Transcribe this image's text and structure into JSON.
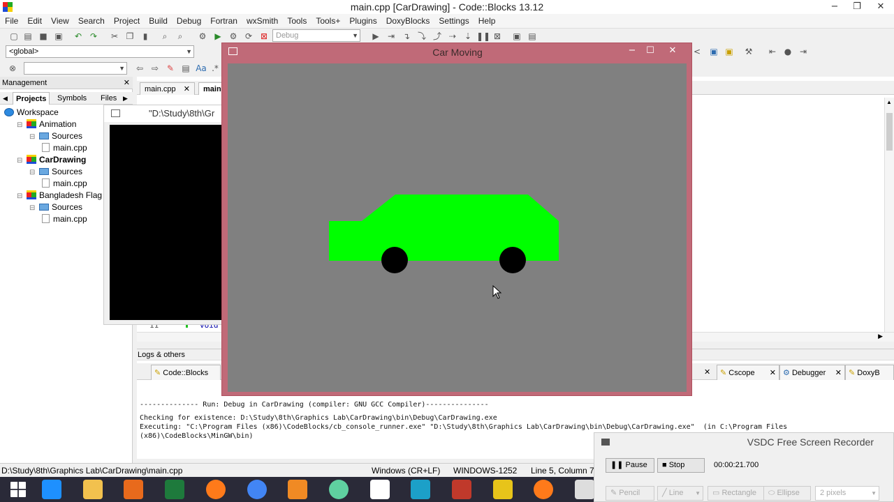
{
  "window": {
    "title": "main.cpp [CarDrawing] - Code::Blocks 13.12",
    "minimize": "−",
    "restore": "❐",
    "close": "✕"
  },
  "menu": [
    "File",
    "Edit",
    "View",
    "Search",
    "Project",
    "Build",
    "Debug",
    "Fortran",
    "wxSmith",
    "Tools",
    "Tools+",
    "Plugins",
    "DoxyBlocks",
    "Settings",
    "Help"
  ],
  "toolbar": {
    "build_target": "Debug",
    "scope": "<global>",
    "search_value": ""
  },
  "management": {
    "title": "Management",
    "close": "✕",
    "tabs": [
      "Projects",
      "Symbols",
      "Files"
    ],
    "tree": [
      {
        "label": "Workspace",
        "level": 0,
        "kind": "workspace"
      },
      {
        "label": "Animation",
        "level": 1,
        "kind": "project"
      },
      {
        "label": "Sources",
        "level": 2,
        "kind": "folder"
      },
      {
        "label": "main.cpp",
        "level": 3,
        "kind": "file"
      },
      {
        "label": "CarDrawing",
        "level": 1,
        "kind": "project",
        "active": true
      },
      {
        "label": "Sources",
        "level": 2,
        "kind": "folder"
      },
      {
        "label": "main.cpp",
        "level": 3,
        "kind": "file"
      },
      {
        "label": "Bangladesh Flag",
        "level": 1,
        "kind": "project"
      },
      {
        "label": "Sources",
        "level": 2,
        "kind": "folder"
      },
      {
        "label": "main.cpp",
        "level": 3,
        "kind": "file"
      }
    ]
  },
  "editor": {
    "tabs": [
      "main.cpp",
      "main"
    ],
    "visible_line_number": "11",
    "visible_line_text": "void"
  },
  "console_window": {
    "title": "\"D:\\Study\\8th\\Gr"
  },
  "car_window": {
    "title": "Car Moving",
    "minimize": "−",
    "maximize": "☐",
    "close": "✕",
    "canvas_bg": "#808080",
    "car_color": "#00ff00",
    "wheel_color": "#000000"
  },
  "logs": {
    "title": "Logs & others",
    "tabs_left": [
      "Code::Blocks"
    ],
    "tabs_right": [
      "Cscope",
      "Debugger",
      "DoxyB"
    ],
    "lines": [
      "-------------- Run: Debug in CarDrawing (compiler: GNU GCC Compiler)---------------",
      "Checking for existence: D:\\Study\\8th\\Graphics Lab\\CarDrawing\\bin\\Debug\\CarDrawing.exe",
      "Executing: \"C:\\Program Files (x86)\\CodeBlocks/cb_console_runner.exe\" \"D:\\Study\\8th\\Graphics Lab\\CarDrawing\\bin\\Debug\\CarDrawing.exe\"  (in C:\\Program Files",
      "(x86)\\CodeBlocks\\MinGW\\bin)"
    ]
  },
  "status": {
    "path": "D:\\Study\\8th\\Graphics Lab\\CarDrawing\\main.cpp",
    "eol": "Windows (CR+LF)",
    "encoding": "WINDOWS-1252",
    "position": "Line 5, Column 7"
  },
  "recorder": {
    "title": "VSDC Free Screen Recorder",
    "pause": "Pause",
    "stop": "Stop",
    "time": "00:00:21.700",
    "tools": [
      "Pencil",
      "Line",
      "Rectangle",
      "Ellipse"
    ],
    "pen_size": "2 pixels"
  },
  "taskbar": {
    "apps": [
      "start-icon",
      "internet-explorer-icon",
      "file-explorer-icon",
      "matlab-icon",
      "excel-icon",
      "firefox-icon",
      "chrome-icon",
      "xampp-icon",
      "atom-icon",
      "snipping-icon",
      "codeblocks-taskbar-icon",
      "winrar-icon",
      "recorder-icon",
      "firefox2-icon",
      "window-icon"
    ]
  }
}
